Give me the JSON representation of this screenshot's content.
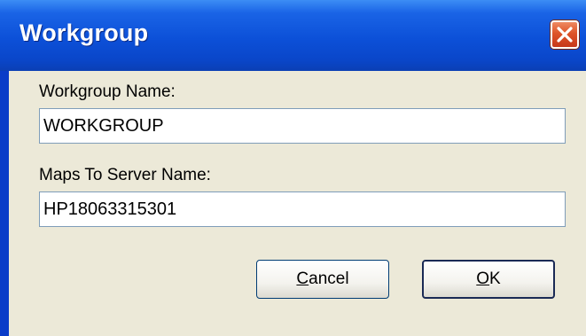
{
  "dialog": {
    "title": "Workgroup",
    "close_icon": "close-icon"
  },
  "form": {
    "workgroup_name_label": "Workgroup Name:",
    "workgroup_name_value": "WORKGROUP",
    "server_name_label": "Maps To Server Name:",
    "server_name_value": "HP18063315301"
  },
  "buttons": {
    "cancel_first": "C",
    "cancel_rest": "ancel",
    "ok_first": "O",
    "ok_rest": "K"
  },
  "colors": {
    "titlebar": "#0c50d8",
    "client_bg": "#ece9d8",
    "close_button": "#de5428"
  }
}
